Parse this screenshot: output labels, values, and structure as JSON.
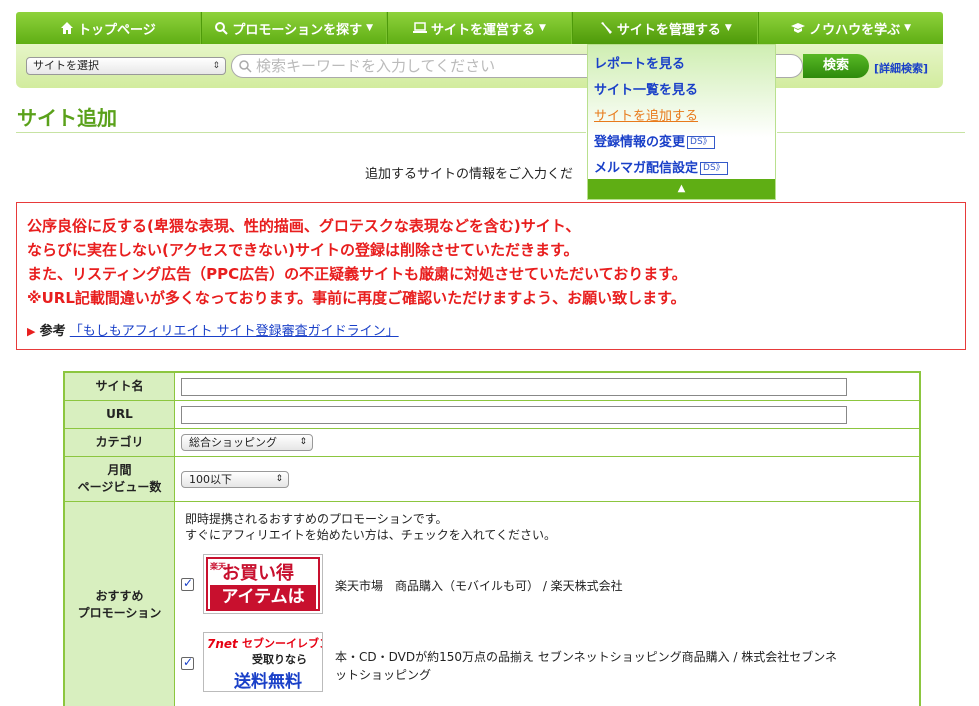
{
  "nav": {
    "items": [
      {
        "label": "トップページ",
        "icon": "home-icon"
      },
      {
        "label": "プロモーションを探す",
        "icon": "search-icon"
      },
      {
        "label": "サイトを運営する",
        "icon": "laptop-icon"
      },
      {
        "label": "サイトを管理する",
        "icon": "wrench-icon"
      },
      {
        "label": "ノウハウを学ぶ",
        "icon": "graduation-cap-icon"
      }
    ]
  },
  "search": {
    "site_select": "サイトを選択",
    "placeholder": "検索キーワードを入力してください",
    "button": "検索",
    "advanced": "[詳細検索]"
  },
  "dropdown": {
    "items": [
      "レポートを見る",
      "サイト一覧を見る",
      "サイトを追加する",
      "登録情報の変更",
      "メルマガ配信設定"
    ],
    "ds_badge": "DS》"
  },
  "page": {
    "title": "サイト追加",
    "intro": "追加するサイトの情報をご入力くだ"
  },
  "warning": {
    "lines": [
      "公序良俗に反する(卑猥な表現、性的描画、グロテスクな表現などを含む)サイト、",
      "ならびに実在しない(アクセスできない)サイトの登録は削除させていただきます。",
      "また、リスティング広告（PPC広告）の不正疑義サイトも厳粛に対処させていただいております。",
      "※URL記載間違いが多くなっております。事前に再度ご確認いただけますよう、お願い致します。"
    ],
    "ref_label": "参考",
    "ref_link": "「もしもアフィリエイト サイト登録審査ガイドライン」"
  },
  "form": {
    "site_name_label": "サイト名",
    "url_label": "URL",
    "category_label": "カテゴリ",
    "category_value": "総合ショッピング",
    "pv_label_1": "月間",
    "pv_label_2": "ページビュー数",
    "pv_value": "100以下",
    "promo_label_1": "おすすめ",
    "promo_label_2": "プロモーション",
    "promo_intro_1": "即時提携されるおすすめのプロモーションです。",
    "promo_intro_2": "すぐにアフィリエイトを始めたい方は、チェックを入れてください。",
    "promos": [
      {
        "banner_lines": [
          "楽天",
          "お買い得",
          "アイテムは"
        ],
        "desc": "楽天市場　商品購入（モバイルも可） / 楽天株式会社"
      },
      {
        "banner_lines": [
          "7net",
          "セブンーイレブン",
          "受取りなら",
          "送料無料"
        ],
        "desc_1": "本・CD・DVDが約150万点の品揃え セブンネットショッピング商品購入 / 株式会社セブンネ",
        "desc_2": "ットショッピング"
      }
    ]
  },
  "colors": {
    "nav_green": "#5fae14",
    "title_green": "#5aa11a",
    "warning_red": "#e81e1e",
    "link_blue": "#1a40c8"
  }
}
